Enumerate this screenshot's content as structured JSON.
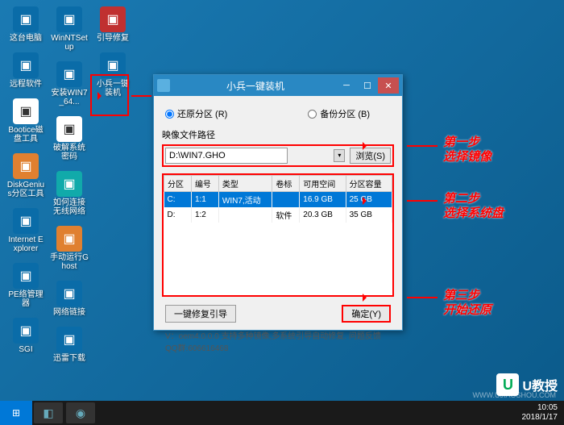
{
  "desktop_icons": {
    "col1": [
      {
        "label": "这台电脑",
        "ic": "ic-blue"
      },
      {
        "label": "远程软件",
        "ic": "ic-blue"
      },
      {
        "label": "Bootice磁盘工具",
        "ic": "ic-white"
      },
      {
        "label": "DiskGenius分区工具",
        "ic": "ic-orange"
      },
      {
        "label": "Internet Explorer",
        "ic": "ic-blue"
      },
      {
        "label": "PE络管理器",
        "ic": "ic-blue"
      },
      {
        "label": "SGI",
        "ic": "ic-blue"
      }
    ],
    "col2": [
      {
        "label": "WinNTSetup",
        "ic": "ic-blue"
      },
      {
        "label": "安装WIN7_64...",
        "ic": "ic-blue"
      },
      {
        "label": "破解系统密码",
        "ic": "ic-white"
      },
      {
        "label": "如何连接无线网络",
        "ic": "ic-teal"
      },
      {
        "label": "手动运行Ghost",
        "ic": "ic-orange"
      },
      {
        "label": "网络链接",
        "ic": "ic-blue"
      },
      {
        "label": "迅雷下载",
        "ic": "ic-blue"
      }
    ],
    "col3": [
      {
        "label": "引导修复",
        "ic": "ic-red"
      },
      {
        "label": "小兵一键装机",
        "ic": "ic-blue"
      }
    ]
  },
  "window": {
    "title": "小兵一键装机",
    "radio_restore": "还原分区 (R)",
    "radio_backup": "备份分区 (B)",
    "path_label": "映像文件路径",
    "path_value": "D:\\WIN7.GHO",
    "browse": "浏览(S)",
    "columns": [
      "分区",
      "编号",
      "类型",
      "卷标",
      "可用空间",
      "分区容量"
    ],
    "rows": [
      {
        "part": "C:",
        "num": "1:1",
        "type": "WIN7,活动",
        "vol": "",
        "free": "16.9 GB",
        "cap": "25 GB",
        "sel": true
      },
      {
        "part": "D:",
        "num": "1:2",
        "type": "",
        "vol": "软件",
        "free": "20.3 GB",
        "cap": "35 GB",
        "sel": false
      }
    ],
    "repair_btn": "一键修复引导",
    "ok_btn": "确定(Y)",
    "version": "V：oem4.0.0.0      支持多种镜像,多系统引导自动修复. 问题反馈QQ群:606616468"
  },
  "annotations": {
    "step1a": "第一步",
    "step1b": "选择镜像",
    "step2a": "第二步",
    "step2b": "选择系统盘",
    "step3a": "第三步",
    "step3b": "开始还原"
  },
  "taskbar": {
    "time": "10:05",
    "date": "2018/1/17"
  },
  "watermark": {
    "text": "U教授",
    "url": "WWW.UJIAOSHOU.COM"
  }
}
